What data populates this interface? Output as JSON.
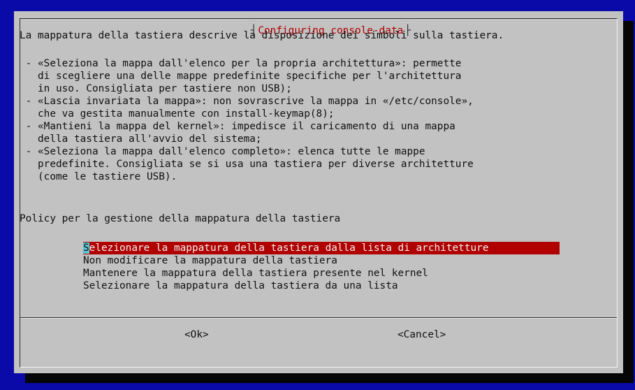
{
  "dialog": {
    "title": "Configuring console-data",
    "body_lines": [
      "La mappatura della tastiera descrive la disposizione dei simboli sulla tastiera.",
      "",
      " - «Seleziona la mappa dall'elenco per la propria architettura»: permette",
      "   di scegliere una delle mappe predefinite specifiche per l'architettura",
      "   in uso. Consigliata per tastiere non USB);",
      " - «Lascia invariata la mappa»: non sovrascrive la mappa in «/etc/console»,",
      "   che va gestita manualmente con install-keymap(8);",
      " - «Mantieni la mappa del kernel»: impedisce il caricamento di una mappa",
      "   della tastiera all'avvio del sistema;",
      " - «Seleziona la mappa dall'elenco completo»: elenca tutte le mappe",
      "   predefinite. Consigliata se si usa una tastiera per diverse architetture",
      "   (come le tastiere USB)."
    ],
    "question": "Policy per la gestione della mappatura della tastiera",
    "selected_first_char": "S",
    "selected_rest": "elezionare la mappatura della tastiera dalla lista di architetture",
    "menu_items": [
      "Selezionare la mappatura della tastiera dalla lista di architetture",
      "Non modificare la mappatura della tastiera",
      "Mantenere la mappatura della tastiera presente nel kernel",
      "Selezionare la mappatura della tastiera da una lista"
    ],
    "ok_label": "<Ok>",
    "cancel_label": "<Cancel>"
  },
  "colors": {
    "background": "#0a0aa8",
    "dialog": "#c2c2c2",
    "accent": "#b00000",
    "cursor": "#56c7d8"
  }
}
